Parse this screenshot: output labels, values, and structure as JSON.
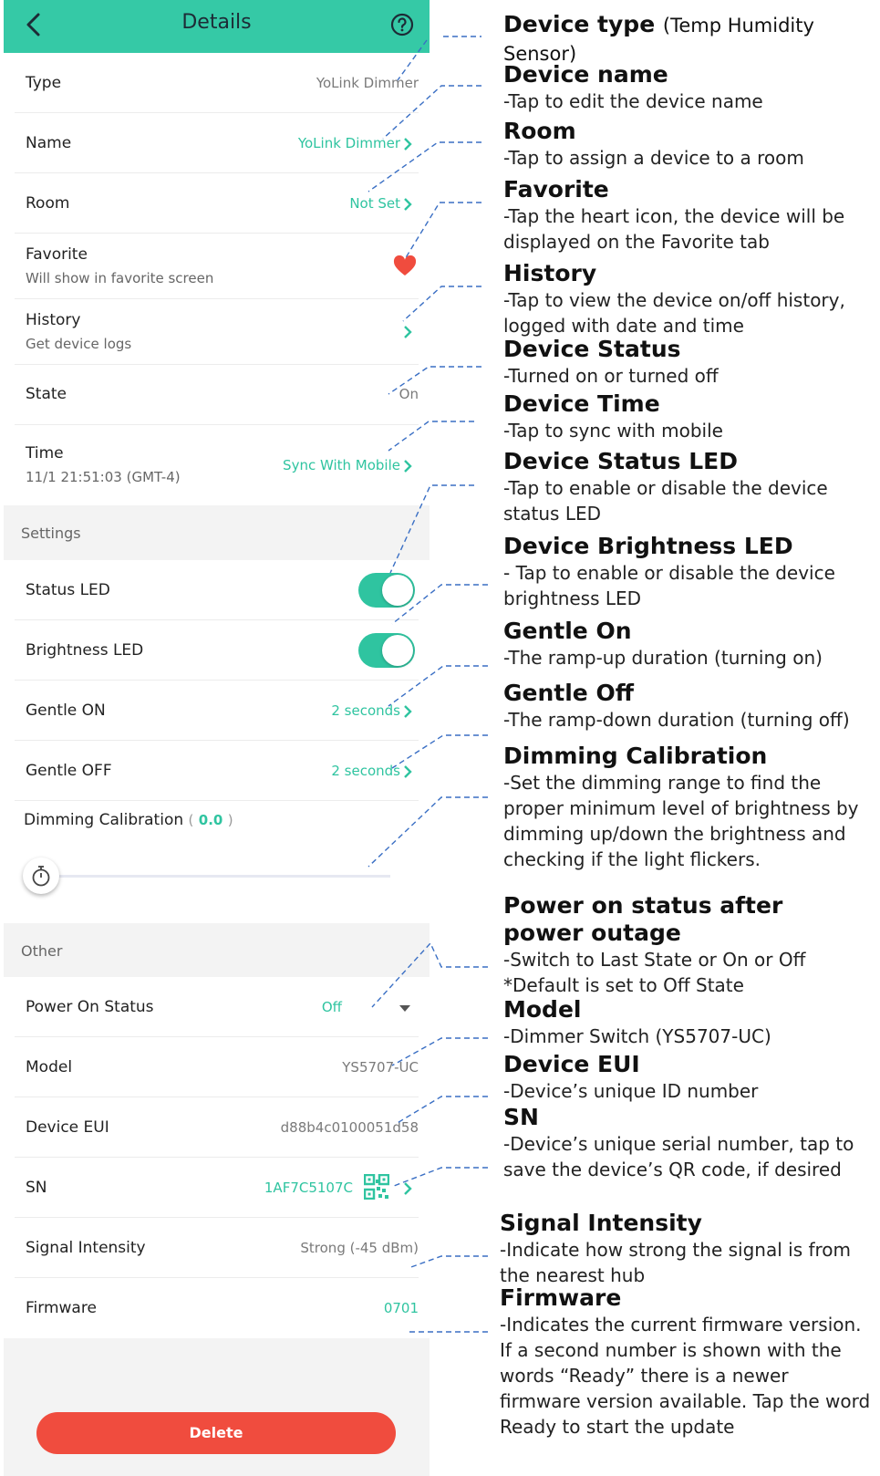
{
  "header": {
    "title": "Details"
  },
  "rows": {
    "type": {
      "label": "Type",
      "value": "YoLink Dimmer"
    },
    "name": {
      "label": "Name",
      "value": "YoLink Dimmer"
    },
    "room": {
      "label": "Room",
      "value": "Not Set"
    },
    "favorite": {
      "label": "Favorite",
      "sub": "Will show in favorite screen"
    },
    "history": {
      "label": "History",
      "sub": "Get device logs"
    },
    "state": {
      "label": "State",
      "value": "On"
    },
    "time": {
      "label": "Time",
      "sub": "11/1 21:51:03 (GMT-4)",
      "value": "Sync With Mobile"
    }
  },
  "settings": {
    "title": "Settings",
    "status_led": {
      "label": "Status LED",
      "enabled": true
    },
    "brightness_led": {
      "label": "Brightness LED",
      "enabled": true
    },
    "gentle_on": {
      "label": "Gentle ON",
      "value": "2 seconds"
    },
    "gentle_off": {
      "label": "Gentle OFF",
      "value": "2 seconds"
    },
    "dimming": {
      "label": "Dimming Calibration",
      "open": "(",
      "value": "0.0",
      "close": ")",
      "slider_fraction": 0.0
    }
  },
  "other": {
    "title": "Other",
    "power_on_status": {
      "label": "Power On Status",
      "value": "Off"
    },
    "model": {
      "label": "Model",
      "value": "YS5707-UC"
    },
    "device_eui": {
      "label": "Device EUI",
      "value": "d88b4c0100051d58"
    },
    "sn": {
      "label": "SN",
      "value": "1AF7C5107C"
    },
    "signal": {
      "label": "Signal Intensity",
      "value": "Strong (-45 dBm)"
    },
    "firmware": {
      "label": "Firmware",
      "value": "0701"
    }
  },
  "delete_label": "Delete",
  "colors": {
    "accent": "#35c9a6",
    "teal_text": "#2fc4a0",
    "delete": "#f04c3e",
    "heart": "#f04c3e",
    "leader": "#3a6fc4"
  },
  "annotations": [
    {
      "title": "Device type",
      "aside": "(Temp Humidity Sensor)",
      "desc": ""
    },
    {
      "title": "Device name",
      "desc": "-Tap to edit the device name"
    },
    {
      "title": "Room",
      "desc": "-Tap to assign a device to a room"
    },
    {
      "title": "Favorite",
      "desc": "-Tap the heart icon, the device will be displayed on the Favorite tab"
    },
    {
      "title": "History",
      "desc": "-Tap to view the device on/off history, logged with date and time"
    },
    {
      "title": "Device Status",
      "desc": "-Turned on or turned off"
    },
    {
      "title": "Device Time",
      "desc": "-Tap to sync with mobile"
    },
    {
      "title": "Device Status LED",
      "desc": "-Tap to enable or disable the device status LED"
    },
    {
      "title": "Device Brightness LED",
      "desc": "- Tap to enable or disable the device brightness LED"
    },
    {
      "title": "Gentle On",
      "desc": "-The ramp-up duration (turning on)"
    },
    {
      "title": "Gentle Off",
      "desc": "-The ramp-down duration (turning off)"
    },
    {
      "title": "Dimming Calibration",
      "desc": "-Set the dimming range to find the proper minimum level of brightness by dimming up/down the brightness and checking if the light flickers."
    },
    {
      "title": "Power on status after power outage",
      "desc": "-Switch to Last State or On or Off *Default is set to Off State"
    },
    {
      "title": "Model",
      "desc": "-Dimmer Switch (YS5707-UC)"
    },
    {
      "title": "Device EUI",
      "desc": "-Device’s unique ID number"
    },
    {
      "title": "SN",
      "desc": "-Device’s unique serial number, tap to save the device’s QR code, if desired"
    },
    {
      "title": "Signal Intensity",
      "desc": "-Indicate how strong the signal is from the nearest hub"
    },
    {
      "title": "Firmware",
      "desc": "-Indicates the current firmware version. If a second number is shown with the words “Ready” there is a newer firmware version available. Tap the word Ready to start the update"
    }
  ]
}
